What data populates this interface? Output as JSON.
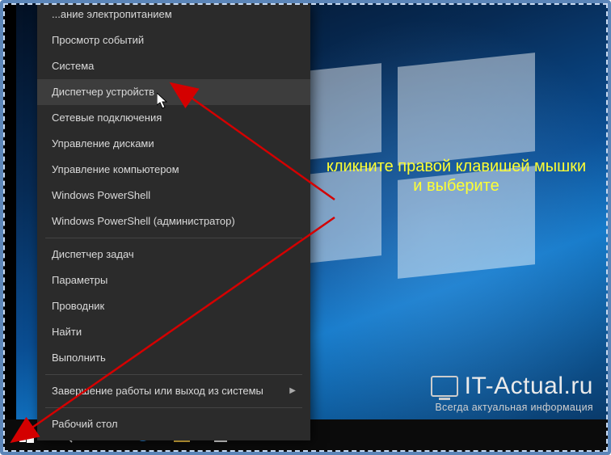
{
  "menu": {
    "items": [
      {
        "label": "...ание электропитанием",
        "partial": true
      },
      {
        "label": "Просмотр событий"
      },
      {
        "label": "Система"
      },
      {
        "label": "Диспетчер устройств",
        "highlight": true
      },
      {
        "label": "Сетевые подключения"
      },
      {
        "label": "Управление дисками"
      },
      {
        "label": "Управление компьютером"
      },
      {
        "label": "Windows PowerShell"
      },
      {
        "label": "Windows PowerShell (администратор)"
      }
    ],
    "items2": [
      {
        "label": "Диспетчер задач"
      },
      {
        "label": "Параметры"
      },
      {
        "label": "Проводник"
      },
      {
        "label": "Найти"
      },
      {
        "label": "Выполнить"
      }
    ],
    "items3": [
      {
        "label": "Завершение работы или выход из системы",
        "submenu": true
      }
    ],
    "items4": [
      {
        "label": "Рабочий стол"
      }
    ]
  },
  "annotation": {
    "line1": "кликните правой клавишей мышки",
    "line2": "и выберите"
  },
  "watermark": {
    "title": "IT-Actual.ru",
    "subtitle": "Всегда актуальная информация"
  },
  "taskbar": {
    "start": "start-icon",
    "search": "search-icon",
    "taskview": "task-view-icon",
    "edge": "edge-icon",
    "explorer": "file-explorer-icon",
    "store": "store-icon"
  },
  "colors": {
    "menuBg": "#2b2b2b",
    "menuHighlight": "#3d3d3d",
    "annotation": "#ffff33",
    "arrow": "#d40000"
  }
}
